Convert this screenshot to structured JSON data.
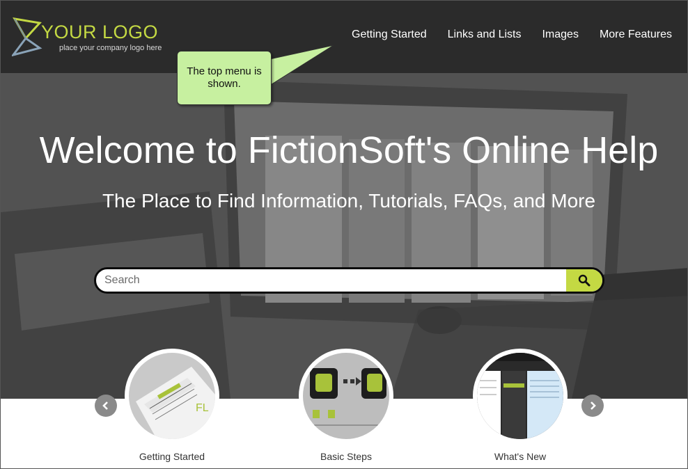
{
  "logo": {
    "title": "YOUR LOGO",
    "tagline": "place your company logo here"
  },
  "nav": {
    "items": [
      {
        "label": "Getting Started"
      },
      {
        "label": "Links and Lists"
      },
      {
        "label": "Images"
      },
      {
        "label": "More Features"
      }
    ]
  },
  "callout": {
    "text": "The top menu is shown."
  },
  "hero": {
    "title": "Welcome to FictionSoft's Online Help",
    "subtitle": "The Place to Find Information, Tutorials, FAQs, and More"
  },
  "search": {
    "placeholder": "Search",
    "icon": "search-icon"
  },
  "carousel": {
    "prev_icon": "chevron-left-icon",
    "next_icon": "chevron-right-icon",
    "cards": [
      {
        "label": "Getting Started",
        "image": "getting-started-thumbnail"
      },
      {
        "label": "Basic Steps",
        "image": "basic-steps-thumbnail"
      },
      {
        "label": "What's New",
        "image": "whats-new-thumbnail"
      }
    ]
  },
  "colors": {
    "accent": "#c4d943",
    "header_bg": "#2b2b2b",
    "callout_bg": "#c7f0a0"
  }
}
